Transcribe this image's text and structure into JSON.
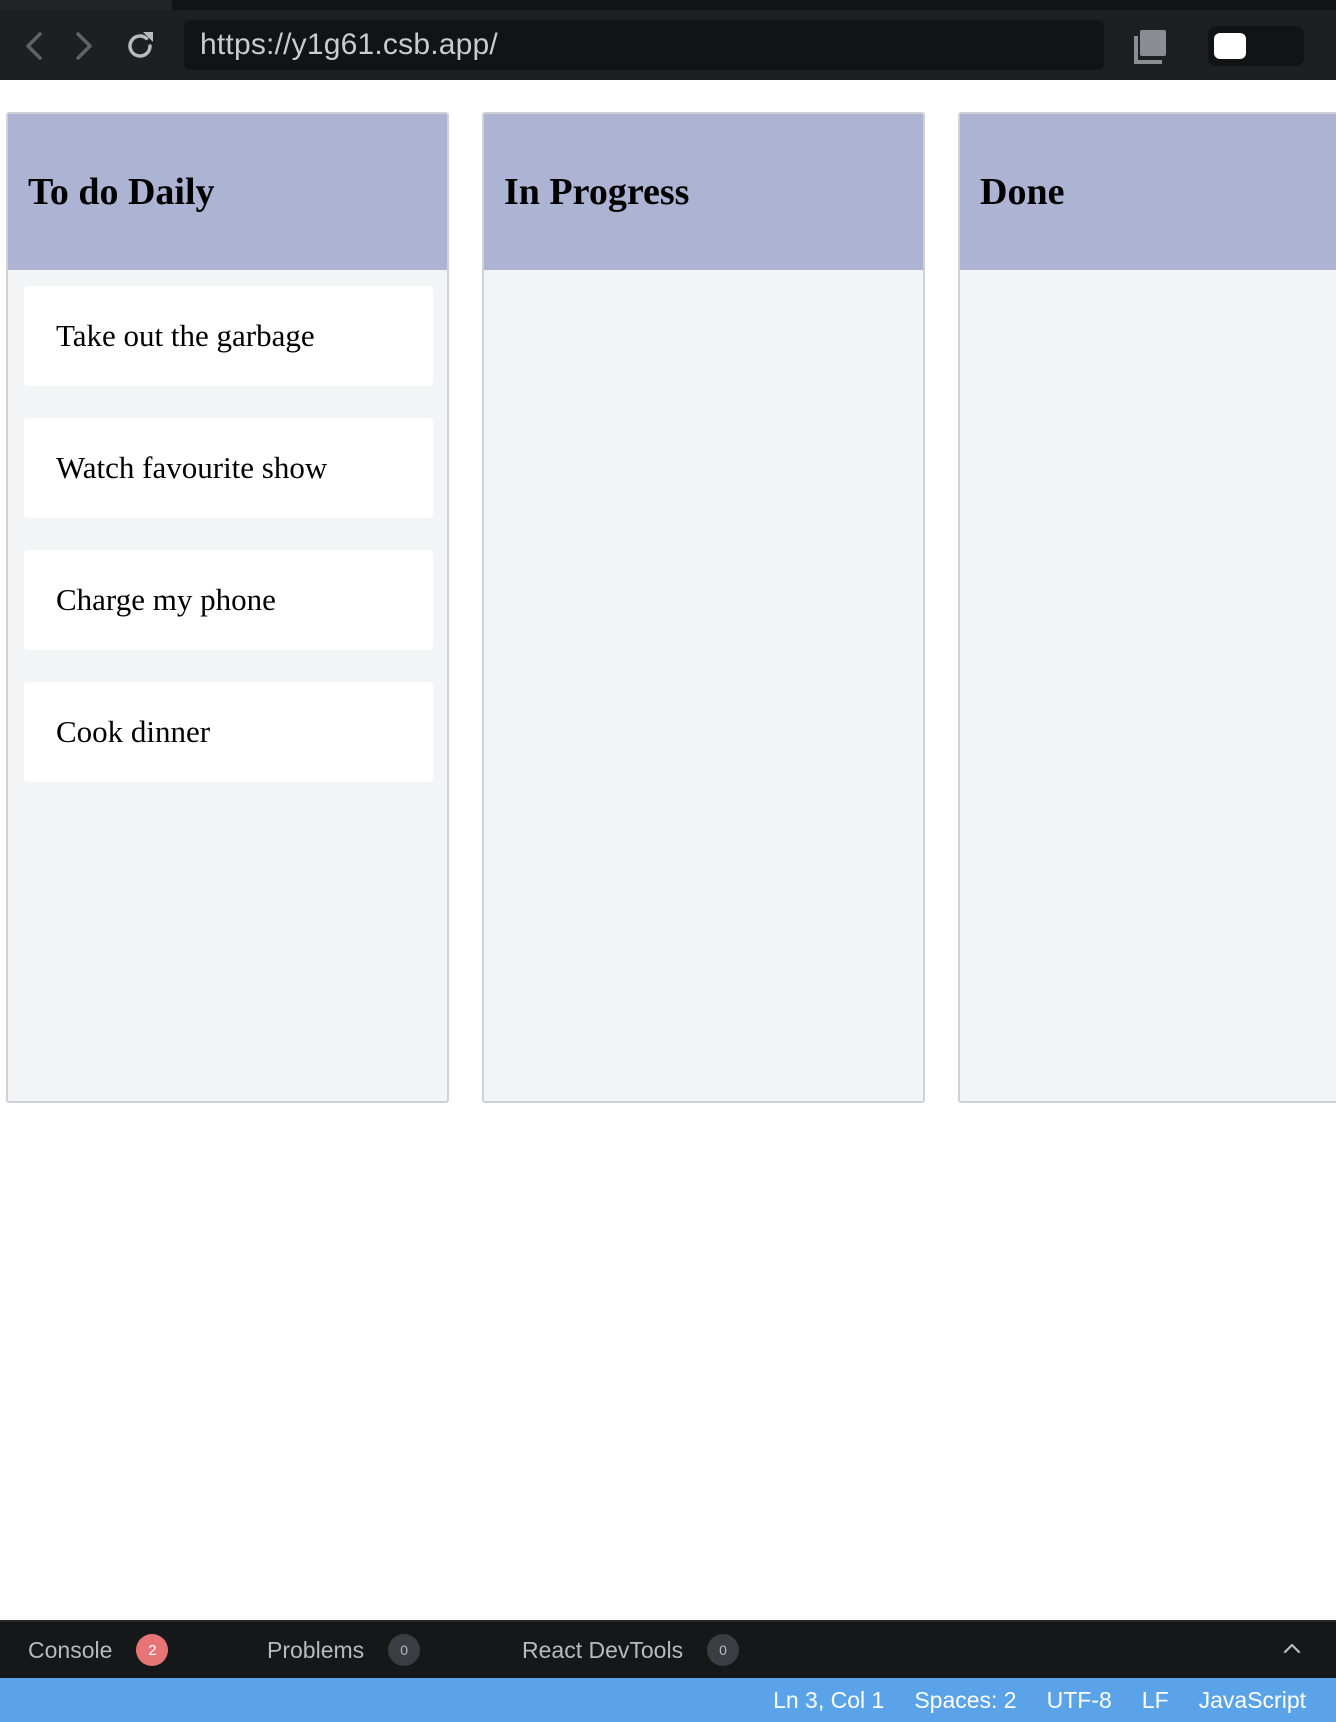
{
  "browser": {
    "url": "https://y1g61.csb.app/",
    "icons": [
      "back-arrow-icon",
      "forward-arrow-icon",
      "reload-icon",
      "copy-icon",
      "theme-toggle"
    ]
  },
  "board": {
    "columns": [
      {
        "title": "To do Daily",
        "cards": [
          "Take out the garbage",
          "Watch favourite show",
          "Charge my phone",
          "Cook dinner"
        ]
      },
      {
        "title": "In Progress",
        "cards": []
      },
      {
        "title": "Done",
        "cards": []
      }
    ],
    "colors": {
      "header": "#adb4d3",
      "column_bg": "#f3f4f6",
      "card_bg": "#ffffff"
    }
  },
  "devtools": {
    "tabs": [
      {
        "label": "Console",
        "badge": "2"
      },
      {
        "label": "Problems",
        "badge": "0"
      },
      {
        "label": "React DevTools",
        "badge": "0"
      }
    ],
    "collapse_icon": "chevron-up-icon"
  },
  "status": {
    "position": "Ln 3, Col 1",
    "spaces": "Spaces: 2",
    "encoding": "UTF-8",
    "eol": "LF",
    "language": "JavaScript",
    "color": "#5aa3e8"
  }
}
